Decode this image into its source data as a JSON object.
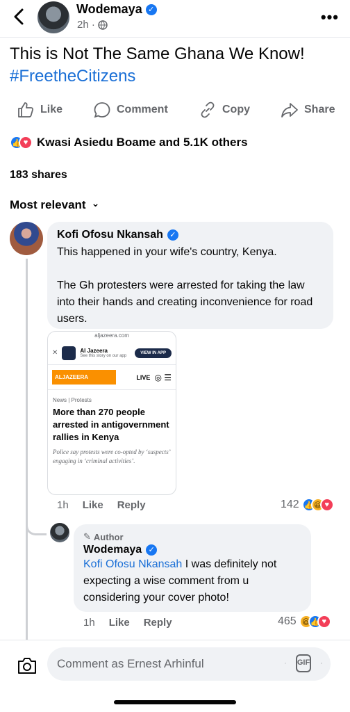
{
  "header": {
    "page_name": "Wodemaya",
    "time": "2h ·",
    "more": "•••"
  },
  "post": {
    "text": "This is Not The Same Ghana We Know!",
    "hashtag": "#FreetheCitizens"
  },
  "actions": {
    "like": "Like",
    "comment": "Comment",
    "copy": "Copy",
    "share": "Share"
  },
  "reactions": {
    "summary": "Kwasi Asiedu Boame and 5.1K others"
  },
  "shares": "183 shares",
  "sort": {
    "label": "Most relevant",
    "chevron": "⌄"
  },
  "comments": [
    {
      "name": "Kofi Ofosu Nkansah",
      "para1": "This happened in your wife's country, Kenya.",
      "para2": "The Gh protesters were arrested for taking the law into their hands and creating inconvenience for road users.",
      "card": {
        "url": "aljazeera.com",
        "app_name": "Al Jazeera",
        "app_sub": "See this story on our app",
        "view_btn": "VIEW IN APP",
        "brand": "ALJAZEERA",
        "live": "LIVE",
        "category": "News | Protests",
        "headline": "More than 270 people arrested in antigovernment rallies in Kenya",
        "subtitle": "Police say protests were co-opted by ‘suspects’ engaging in ‘criminal activities’."
      },
      "time": "1h",
      "like": "Like",
      "reply": "Reply",
      "reaction_count": "142"
    },
    {
      "author_label": "Author",
      "name": "Wodemaya",
      "mention": "Kofi Ofosu Nkansah",
      "text": " I was definitely not expecting a wise comment from u considering your cover photo!",
      "time": "1h",
      "like": "Like",
      "reply": "Reply",
      "reaction_count": "465"
    }
  ],
  "composer": {
    "placeholder": "Comment as Ernest Arhinful",
    "gif": "GIF"
  }
}
